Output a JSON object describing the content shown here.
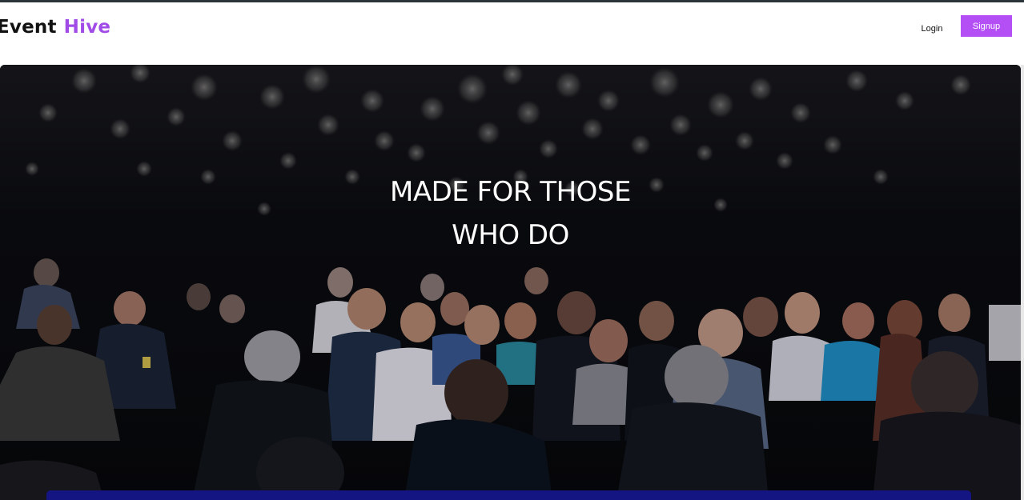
{
  "brand": {
    "first": "Event",
    "second": "Hive",
    "accent_color": "#a24ce8"
  },
  "nav": {
    "login_label": "Login",
    "signup_label": "Signup",
    "signup_color": "#b34ff5"
  },
  "hero": {
    "headline_line1": "MADE FOR THOSE",
    "headline_line2": "WHO DO",
    "background": "photo of conference audience in dark auditorium"
  },
  "colors": {
    "top_border": "#2b3438",
    "bottom_panel": "#141582"
  }
}
